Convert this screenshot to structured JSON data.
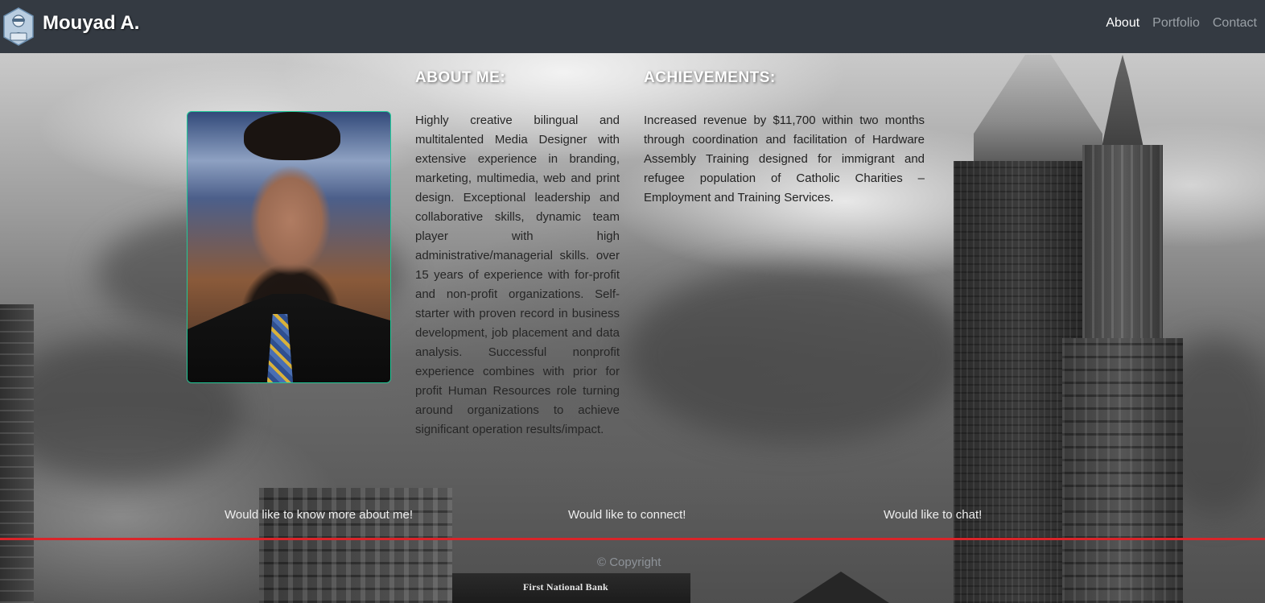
{
  "header": {
    "brand": "Mouyad A.",
    "logo_icon": "developer-avatar-icon",
    "nav": [
      {
        "label": "About",
        "active": true
      },
      {
        "label": "Portfolio",
        "active": false
      },
      {
        "label": "Contact",
        "active": false
      }
    ],
    "background_color": "#343a42"
  },
  "about": {
    "title": "ABOUT ME:",
    "text": "Highly creative bilingual and multitalented Media Designer with extensive experience in branding, marketing, multimedia, web and print design. Exceptional leadership and collaborative skills, dynamic team player with high administrative/managerial skills. over 15 years of experience with for-profit and non-profit organizations. Self-starter with proven record in business development, job placement and data analysis. Successful nonprofit experience combines with prior for profit Human Resources role turning around organizations to achieve significant operation results/impact."
  },
  "achievements": {
    "title": "ACHIEVEMENTS:",
    "text": "Increased revenue by $11,700 within two months through coordination and facilitation of Hardware Assembly Training designed for immigrant and refugee population of Catholic Charities – Employment and Training Services."
  },
  "footer": {
    "links": [
      "Would like to know more about me!",
      "Would like to connect!",
      "Would like to chat!"
    ],
    "copyright": "© Copyright",
    "divider_color": "#d9252a"
  },
  "background": {
    "bank_sign": "First National Bank"
  },
  "colors": {
    "photo_border": "#20c997"
  }
}
